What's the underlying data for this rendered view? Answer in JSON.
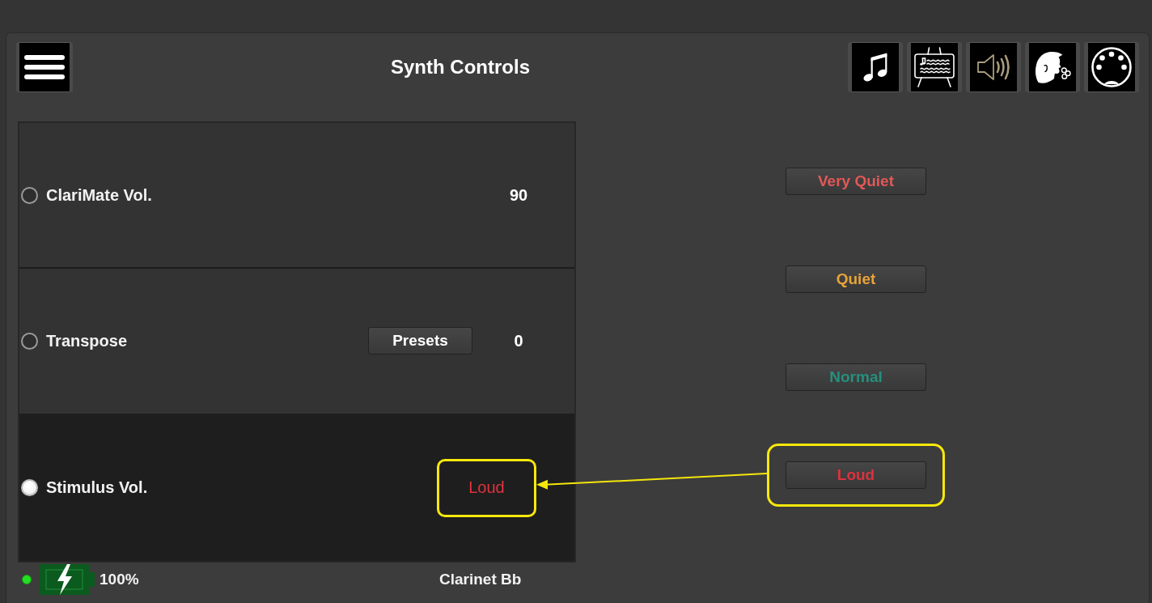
{
  "header": {
    "title": "Synth Controls",
    "toolbar": [
      {
        "kind": "notes",
        "selected": false
      },
      {
        "kind": "score",
        "selected": false
      },
      {
        "kind": "speaker",
        "selected": true
      },
      {
        "kind": "breath",
        "selected": false
      },
      {
        "kind": "connector",
        "selected": false
      }
    ]
  },
  "settings": [
    {
      "label": "ClariMate Vol.",
      "kind": "number",
      "value": "90",
      "color": "#ffffff",
      "selected": false,
      "highlighted": false
    },
    {
      "label": "Transpose",
      "kind": "number",
      "button": "Presets",
      "value": "0",
      "color": "#ffffff",
      "selected": false,
      "highlighted": false
    },
    {
      "label": "Stimulus Vol.",
      "kind": "choice",
      "value": "Loud",
      "color": "#e0343f",
      "selected": true,
      "highlighted": true
    }
  ],
  "options": [
    {
      "label": "Very Quiet",
      "color": "#e35856",
      "highlighted": false
    },
    {
      "label": "Quiet",
      "color": "#e8a43a",
      "highlighted": false
    },
    {
      "label": "Normal",
      "color": "#26907f",
      "highlighted": false
    },
    {
      "label": "Loud",
      "color": "#dd323d",
      "highlighted": true
    }
  ],
  "status_bar": {
    "connected": true,
    "battery": "100%",
    "instrument": "Clarinet Bb"
  }
}
